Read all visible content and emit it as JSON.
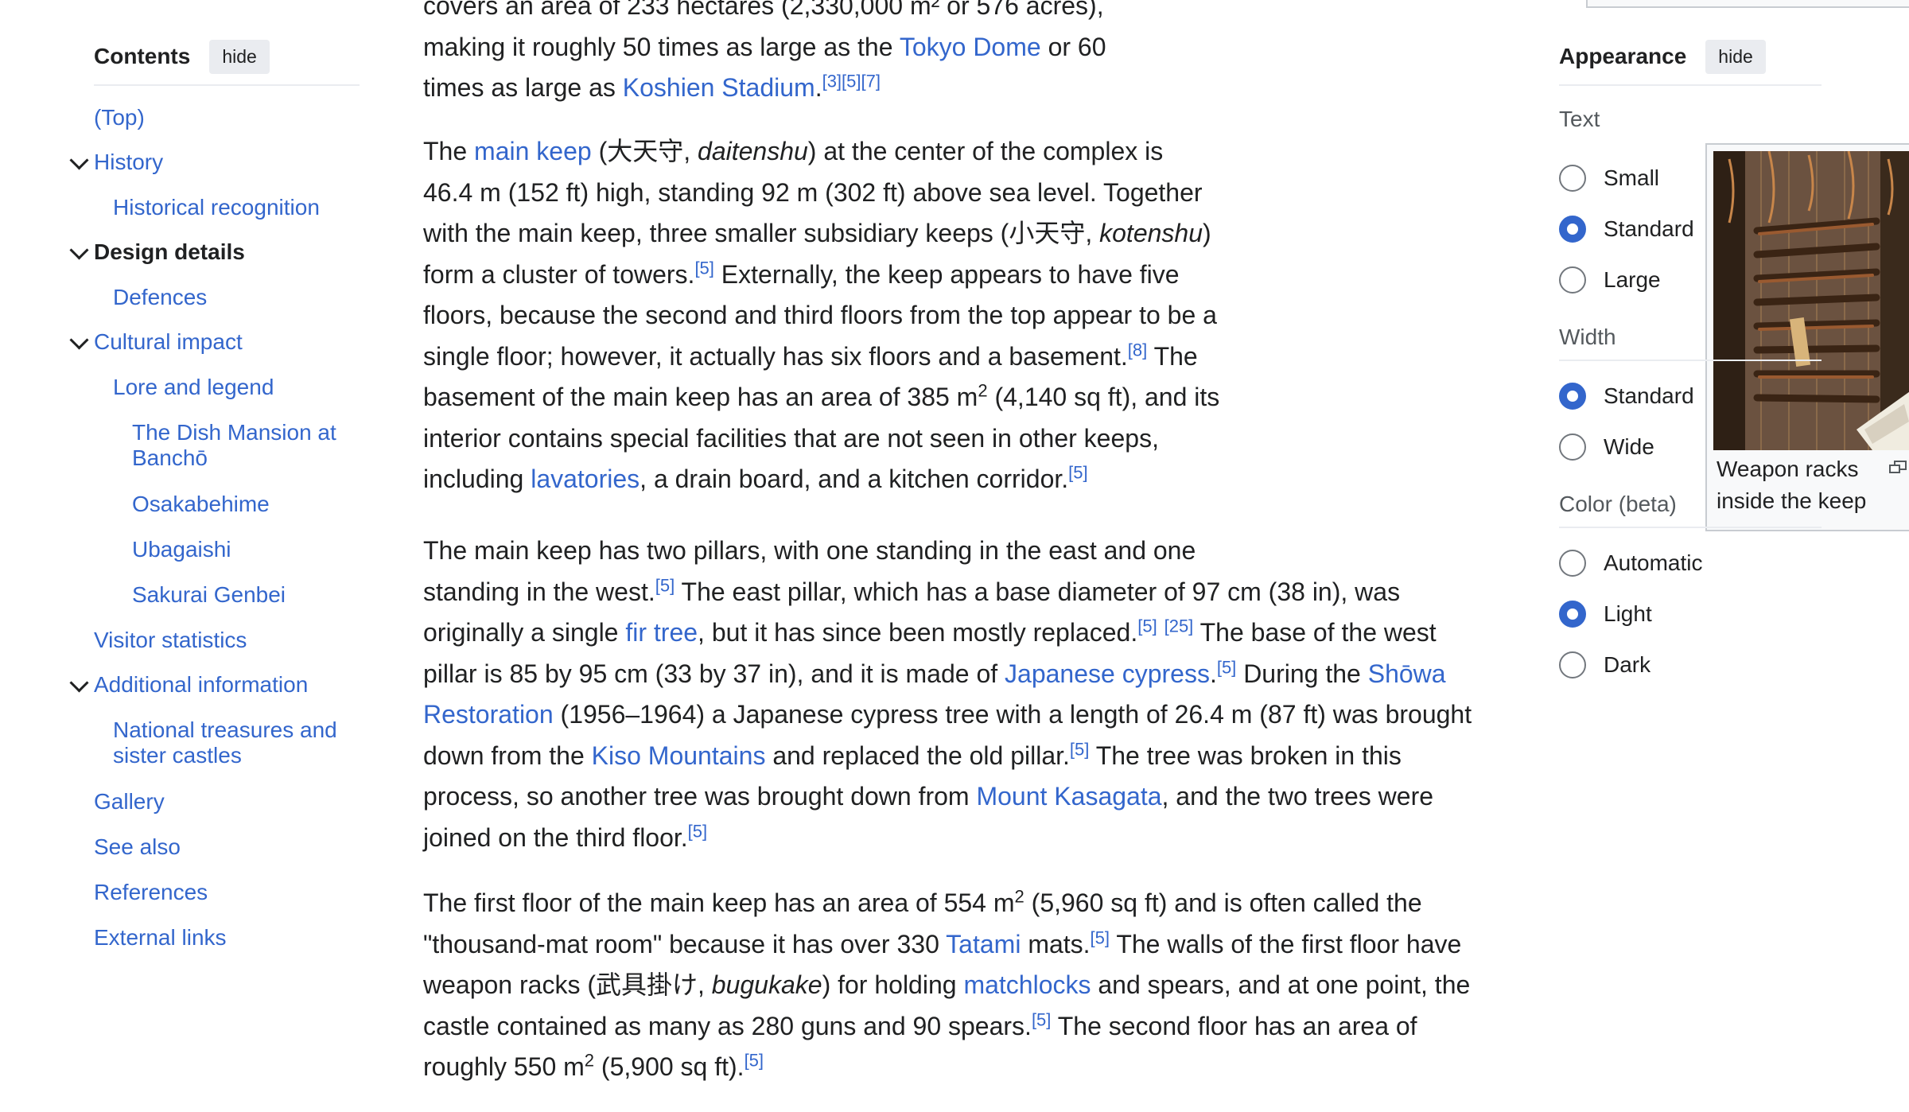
{
  "toc": {
    "title": "Contents",
    "hide_label": "hide",
    "items": [
      {
        "label": "(Top)"
      },
      {
        "label": "History"
      },
      {
        "label": "Historical recognition"
      },
      {
        "label": "Design details"
      },
      {
        "label": "Defences"
      },
      {
        "label": "Cultural impact"
      },
      {
        "label": "Lore and legend"
      },
      {
        "label": "The Dish Mansion at Banchō"
      },
      {
        "label": "Osakabehime"
      },
      {
        "label": "Ubagaishi"
      },
      {
        "label": "Sakurai Genbei"
      },
      {
        "label": "Visitor statistics"
      },
      {
        "label": "Additional information"
      },
      {
        "label": "National treasures and sister castles"
      },
      {
        "label": "Gallery"
      },
      {
        "label": "See also"
      },
      {
        "label": "References"
      },
      {
        "label": "External links"
      }
    ]
  },
  "article": {
    "p0": {
      "l1": "covers an area of 233 hectares (2,330,000 m² or 576 acres),",
      "l2a": "making it roughly 50 times as large as the ",
      "l2link": "Tokyo Dome",
      "l2b": " or 60",
      "l3a": "times as large as ",
      "l3link": "Koshien Stadium",
      "l3b": ".",
      "l3ref": "[3][5][7]"
    },
    "p1": {
      "a": "The ",
      "link_keep": "main keep",
      "b": " (大天守, ",
      "b_i": "daitenshu",
      "c": ") at the center of the complex is",
      "l2": "46.4 m (152 ft) high, standing 92 m (302 ft) above sea level. Together",
      "l3a": "with the main keep, three smaller subsidiary keeps (小天守, ",
      "l3i": "kotenshu",
      "l3b": ")",
      "l4a": "form a cluster of towers.",
      "l4ref": "[5]",
      "l4b": " Externally, the keep appears to have five",
      "l5": "floors, because the second and third floors from the top appear to be a",
      "l6a": "single floor; however, it actually has six floors and a basement.",
      "l6ref": "[8]",
      "l6b": " The",
      "l7a": "basement of the main keep has an area of 385 m",
      "l7sup": "2",
      "l7b": " (4,140 sq ft), and its",
      "l8": "interior contains special facilities that are not seen in other keeps,",
      "l9a": "including ",
      "l9link": "lavatories",
      "l9b": ", a drain board, and a kitchen corridor.",
      "l9ref": "[5]"
    },
    "p2": {
      "l1": "The main keep has two pillars, with one standing in the east and one",
      "l2a": "standing in the west.",
      "l2ref": "[5]",
      "l2b": " The east pillar, which has a base diameter of 97 cm (38 in), was",
      "l3a": "originally a single ",
      "l3link": "fir tree",
      "l3b": ", but it has since been mostly replaced.",
      "l3ref1": "[5]",
      "l3ref2": "[25]",
      "l3c": " The base of the west",
      "l4a": "pillar is 85 by 95 cm (33 by 37 in), and it is made of ",
      "l4link": "Japanese cypress",
      "l4b": ".",
      "l4ref": "[5]",
      "l4c": " During the ",
      "l4link2": "Shōwa",
      "l5link": "Restoration",
      "l5b": " (1956–1964) a Japanese cypress tree with a length of 26.4 m (87 ft) was brought",
      "l6a": "down from the ",
      "l6link": "Kiso Mountains",
      "l6b": " and replaced the old pillar.",
      "l6ref": "[5]",
      "l6c": " The tree was broken in this",
      "l7a": "process, so another tree was brought down from ",
      "l7link": "Mount Kasagata",
      "l7b": ", and the two trees were",
      "l8a": "joined on the third floor.",
      "l8ref": "[5]"
    },
    "p3": {
      "l1a": "The first floor of the main keep has an area of 554 m",
      "l1sup": "2",
      "l1b": " (5,960 sq ft) and is often called the",
      "l2a": "\"thousand-mat room\" because it has over 330 ",
      "l2link": "Tatami",
      "l2b": " mats.",
      "l2ref": "[5]",
      "l2c": " The walls of the first floor have",
      "l3a": "weapon racks (武具掛け, ",
      "l3i": "bugukake",
      "l3b": ") for holding ",
      "l3link": "matchlocks",
      "l3c": " and spears, and at one point, the",
      "l4a": "castle contained as many as 280 guns and 90 spears.",
      "l4ref": "[5]",
      "l4b": " The second floor has an area of",
      "l5a": "roughly 550 m",
      "l5sup": "2",
      "l5b": " (5,900 sq ft).",
      "l5ref": "[5]"
    },
    "thumb": {
      "caption": "Weapon racks inside the keep"
    }
  },
  "appearance": {
    "title": "Appearance",
    "hide_label": "hide",
    "text_label": "Text",
    "text_options": [
      "Small",
      "Standard",
      "Large"
    ],
    "text_selected": "Standard",
    "width_label": "Width",
    "width_options": [
      "Standard",
      "Wide"
    ],
    "width_selected": "Standard",
    "color_label": "Color (beta)",
    "color_options": [
      "Automatic",
      "Light",
      "Dark"
    ],
    "color_selected": "Light"
  }
}
